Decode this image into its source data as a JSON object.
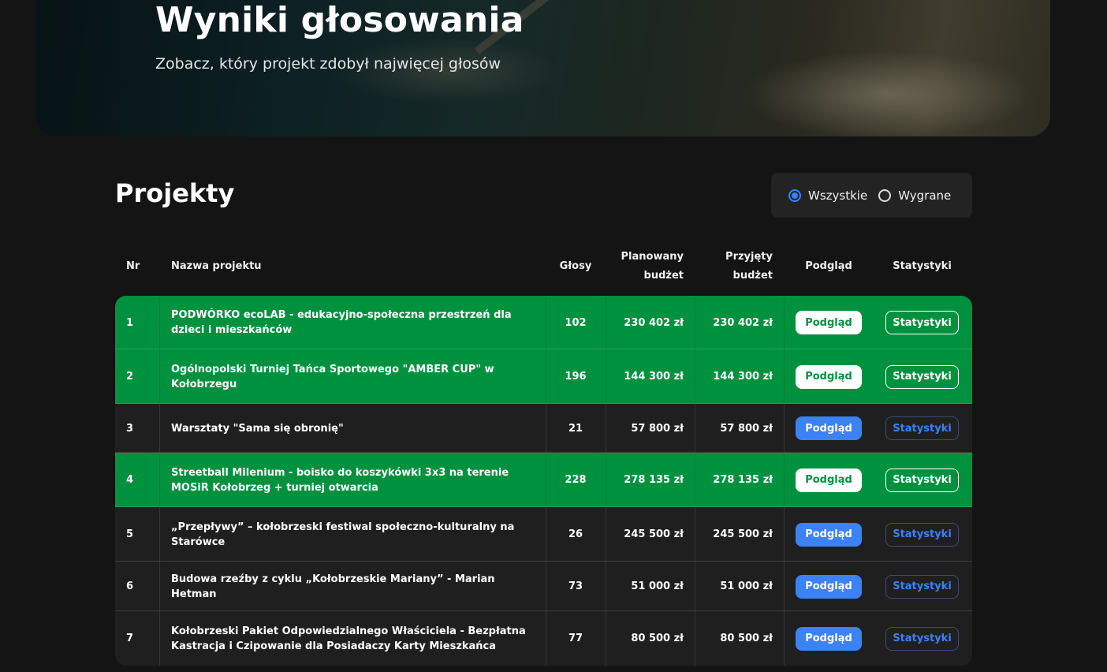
{
  "hero": {
    "title": "Wyniki głosowania",
    "subtitle": "Zobacz, który projekt zdobył najwięcej głosów"
  },
  "section": {
    "title": "Projekty"
  },
  "filter": {
    "options": [
      {
        "label": "Wszystkie",
        "selected": true
      },
      {
        "label": "Wygrane",
        "selected": false
      }
    ]
  },
  "table": {
    "headers": {
      "nr": "Nr",
      "name": "Nazwa projektu",
      "votes": "Głosy",
      "planned_line1": "Planowany",
      "planned_line2": "budżet",
      "accepted_line1": "Przyjęty",
      "accepted_line2": "budżet",
      "preview": "Podgląd",
      "stats": "Statystyki"
    },
    "rows": [
      {
        "nr": "1",
        "name": "PODWÓRKO ecoLAB - edukacyjno-społeczna przestrzeń dla dzieci i mieszkańców",
        "votes": "102",
        "planned": "230 402 zł",
        "accepted": "230 402 zł",
        "preview": "Podgląd",
        "stats": "Statystyki",
        "winner": true
      },
      {
        "nr": "2",
        "name": "Ogólnopolski Turniej Tańca Sportowego \"AMBER CUP\" w Kołobrzegu",
        "votes": "196",
        "planned": "144 300 zł",
        "accepted": "144 300 zł",
        "preview": "Podgląd",
        "stats": "Statystyki",
        "winner": true
      },
      {
        "nr": "3",
        "name": "Warsztaty \"Sama się obronię\"",
        "votes": "21",
        "planned": "57 800 zł",
        "accepted": "57 800 zł",
        "preview": "Podgląd",
        "stats": "Statystyki",
        "winner": false
      },
      {
        "nr": "4",
        "name": "Streetball Milenium - boisko do koszykówki 3x3 na terenie MOSiR Kołobrzeg + turniej otwarcia",
        "votes": "228",
        "planned": "278 135 zł",
        "accepted": "278 135 zł",
        "preview": "Podgląd",
        "stats": "Statystyki",
        "winner": true
      },
      {
        "nr": "5",
        "name": "„Przepływy” – kołobrzeski festiwal społeczno-kulturalny na Starówce",
        "votes": "26",
        "planned": "245 500 zł",
        "accepted": "245 500 zł",
        "preview": "Podgląd",
        "stats": "Statystyki",
        "winner": false
      },
      {
        "nr": "6",
        "name": "Budowa rzeźby z cyklu „Kołobrzeskie Mariany” - Marian Hetman",
        "votes": "73",
        "planned": "51 000 zł",
        "accepted": "51 000 zł",
        "preview": "Podgląd",
        "stats": "Statystyki",
        "winner": false
      },
      {
        "nr": "7",
        "name": "Kołobrzeski Pakiet Odpowiedzialnego Właściciela - Bezpłatna Kastracja i Czipowanie dla Posiadaczy Karty Mieszkańca",
        "votes": "77",
        "planned": "80 500 zł",
        "accepted": "80 500 zł",
        "preview": "Podgląd",
        "stats": "Statystyki",
        "winner": false
      }
    ]
  },
  "colors": {
    "winner_row": "#00913f",
    "accent_blue": "#3b82f6",
    "background": "#141414",
    "row_dark": "#1f1f1f"
  }
}
